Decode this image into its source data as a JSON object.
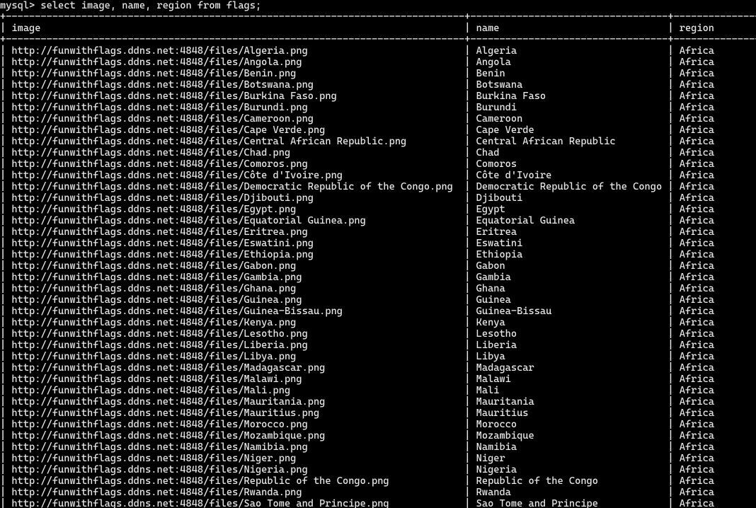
{
  "prompt_prefix": "mysql> ",
  "command": "select image, name, region from flags;",
  "columns": {
    "image_header": "image",
    "name_header": "name",
    "region_header": "region"
  },
  "url_prefix": "http://funwithflags.ddns.net:4848/files/",
  "url_suffix": ".png",
  "rows": [
    {
      "name": "Algeria",
      "region": "Africa"
    },
    {
      "name": "Angola",
      "region": "Africa"
    },
    {
      "name": "Benin",
      "region": "Africa"
    },
    {
      "name": "Botswana",
      "region": "Africa"
    },
    {
      "name": "Burkina Faso",
      "region": "Africa"
    },
    {
      "name": "Burundi",
      "region": "Africa"
    },
    {
      "name": "Cameroon",
      "region": "Africa"
    },
    {
      "name": "Cape Verde",
      "region": "Africa"
    },
    {
      "name": "Central African Republic",
      "region": "Africa"
    },
    {
      "name": "Chad",
      "region": "Africa"
    },
    {
      "name": "Comoros",
      "region": "Africa"
    },
    {
      "name": "Côte d'Ivoire",
      "region": "Africa"
    },
    {
      "name": "Democratic Republic of the Congo",
      "region": "Africa"
    },
    {
      "name": "Djibouti",
      "region": "Africa"
    },
    {
      "name": "Egypt",
      "region": "Africa"
    },
    {
      "name": "Equatorial Guinea",
      "region": "Africa"
    },
    {
      "name": "Eritrea",
      "region": "Africa"
    },
    {
      "name": "Eswatini",
      "region": "Africa"
    },
    {
      "name": "Ethiopia",
      "region": "Africa"
    },
    {
      "name": "Gabon",
      "region": "Africa"
    },
    {
      "name": "Gambia",
      "region": "Africa"
    },
    {
      "name": "Ghana",
      "region": "Africa"
    },
    {
      "name": "Guinea",
      "region": "Africa"
    },
    {
      "name": "Guinea-Bissau",
      "region": "Africa"
    },
    {
      "name": "Kenya",
      "region": "Africa"
    },
    {
      "name": "Lesotho",
      "region": "Africa"
    },
    {
      "name": "Liberia",
      "region": "Africa"
    },
    {
      "name": "Libya",
      "region": "Africa"
    },
    {
      "name": "Madagascar",
      "region": "Africa"
    },
    {
      "name": "Malawi",
      "region": "Africa"
    },
    {
      "name": "Mali",
      "region": "Africa"
    },
    {
      "name": "Mauritania",
      "region": "Africa"
    },
    {
      "name": "Mauritius",
      "region": "Africa"
    },
    {
      "name": "Morocco",
      "region": "Africa"
    },
    {
      "name": "Mozambique",
      "region": "Africa"
    },
    {
      "name": "Namibia",
      "region": "Africa"
    },
    {
      "name": "Niger",
      "region": "Africa"
    },
    {
      "name": "Nigeria",
      "region": "Africa"
    },
    {
      "name": "Republic of the Congo",
      "region": "Africa"
    },
    {
      "name": "Rwanda",
      "region": "Africa"
    },
    {
      "name": "Sao Tome and Principe",
      "region": "Africa"
    }
  ],
  "col_widths": {
    "image": 79,
    "name": 34,
    "region": 17
  }
}
